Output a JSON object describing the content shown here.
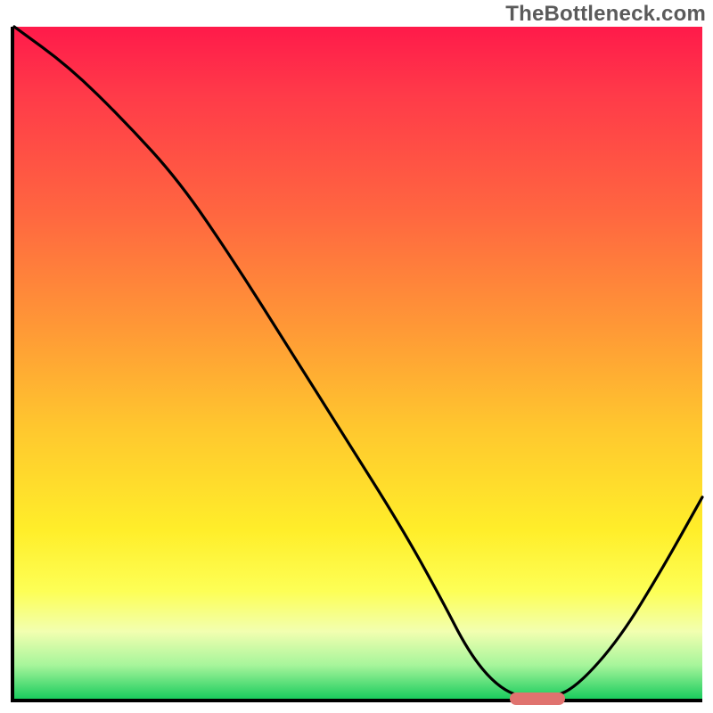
{
  "watermark": "TheBottleneck.com",
  "colors": {
    "gradient_top": "#ff1a4a",
    "gradient_mid1": "#ff9936",
    "gradient_mid2": "#ffee2a",
    "gradient_bottom": "#1acc5e",
    "curve": "#000000",
    "marker": "#e0736f"
  },
  "chart_data": {
    "type": "line",
    "title": "",
    "xlabel": "",
    "ylabel": "",
    "xlim": [
      0,
      100
    ],
    "ylim": [
      0,
      100
    ],
    "grid": false,
    "legend": false,
    "x": [
      0,
      8,
      16,
      24,
      32,
      40,
      48,
      56,
      62,
      66,
      70,
      74,
      78,
      82,
      88,
      94,
      100
    ],
    "values": [
      100,
      94,
      86,
      77,
      65,
      52,
      39,
      26,
      15,
      7,
      2,
      0,
      0,
      2,
      9,
      19,
      30
    ],
    "marker": {
      "x_start": 72,
      "x_end": 80,
      "y": 0
    },
    "notes": "Values are read as percent of plot height from chart baseline; curve descends from top-left, flattens near x≈74–78 at y≈0, then rises toward the right. Marker is a small rounded rectangle on the baseline near the trough."
  }
}
